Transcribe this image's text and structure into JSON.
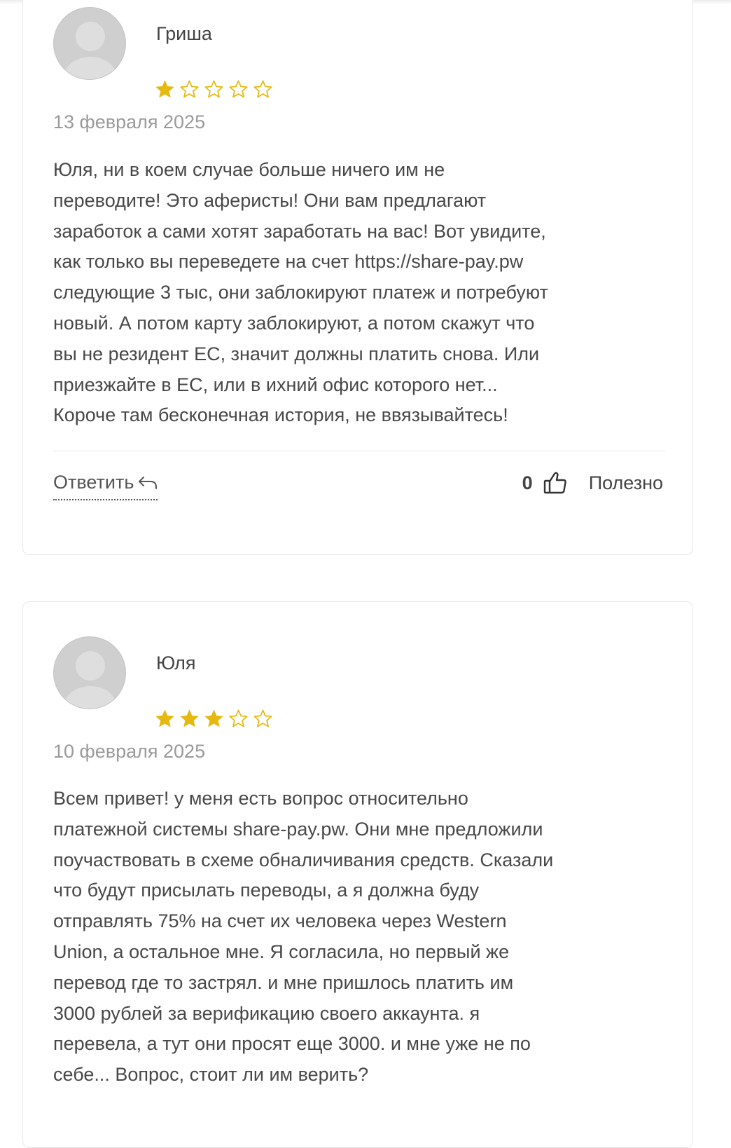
{
  "reviews": [
    {
      "author": "Гриша",
      "rating": 1,
      "max_rating": 5,
      "date": "13 февраля 2025",
      "text": "Юля, ни в коем случае больше ничего им не\nпереводите! Это аферисты! Они вам предлагают\nзаработок а сами хотят заработать на вас! Вот увидите,\nкак только вы переведете на счет https://share-pay.pw\nследующие 3 тыс, они заблокируют платеж и потребуют\nновый. А потом карту заблокируют, а потом скажут что\nвы не резидент ЕС, значит должны платить снова. Или\nприезжайте в ЕС, или в ихний офис которого нет...\nКороче там бесконечная история, не ввязывайтесь!",
      "reply_label": "Ответить",
      "likes": "0",
      "helpful_label": "Полезно"
    },
    {
      "author": "Юля",
      "rating": 3,
      "max_rating": 5,
      "date": "10 февраля 2025",
      "text": "Всем привет! у меня есть вопрос относительно\nплатежной системы share-pay.pw. Они мне предложили\nпоучаствовать в схеме обналичивания средств. Сказали\nчто будут присылать переводы, а я должна буду\nотправлять 75% на счет их человека через Western\nUnion, а остальное мне. Я согласила, но первый же\nперевод где то застрял. и мне пришлось платить им\n3000 рублей за верификацию своего аккаунта. я\nперевела, а тут они просят еще 3000. и мне уже не по\nсебе... Вопрос, стоит ли им верить?"
    }
  ],
  "colors": {
    "star_filled": "#e5b90f",
    "star_empty_outline": "#e5b90f",
    "date": "#9a9a9a",
    "border": "#e6e6e6"
  }
}
